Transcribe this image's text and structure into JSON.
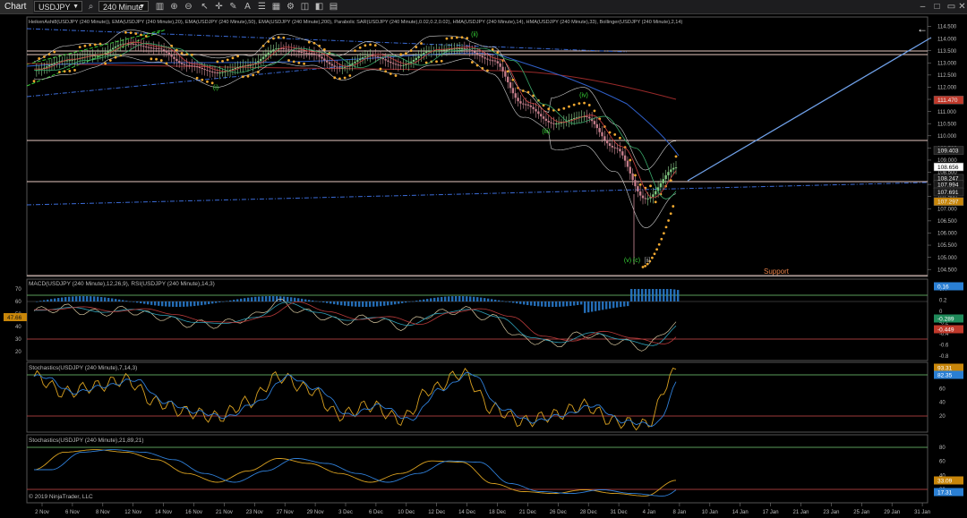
{
  "toolbar": {
    "title": "Chart",
    "instrument": "USDJPY",
    "interval": "240 Minute",
    "icons": [
      "search-icon",
      "zoom-in-icon",
      "zoom-out-icon",
      "crosshair-icon",
      "pointer-icon",
      "draw-icon",
      "text-icon",
      "properties-icon",
      "layout-icon",
      "settings-icon",
      "lock-icon",
      "hide-icon",
      "tile-icon"
    ],
    "window_controls": [
      "minimize-icon",
      "maximize-icon",
      "close-icon"
    ]
  },
  "price_panel": {
    "indicator_label": "HeikenAshi8(USDJPY (240 Minute)), EMA(USDJPY (240 Minute),20), EMA(USDJPY (240 Minute),50), EMA(USDJPY (240 Minute),200), Parabolic SAR(USDJPY (240 Minute),0.02,0.2,0.02), HMA(USDJPY (240 Minute),14), HMA(USDJPY (240 Minute),33), Bollinger(USDJPY (240 Minute),2,14)",
    "y_ticks": [
      "114.500",
      "114.000",
      "113.500",
      "113.000",
      "112.500",
      "112.000",
      "111.500",
      "111.000",
      "110.500",
      "110.000",
      "109.500",
      "109.000",
      "108.500",
      "108.000",
      "107.500",
      "107.000",
      "106.500",
      "106.000",
      "105.500",
      "105.000",
      "104.500"
    ],
    "tick_values": [
      114.5,
      114.0,
      113.5,
      113.0,
      112.5,
      112.0,
      111.5,
      111.0,
      110.5,
      110.0,
      109.5,
      109.0,
      108.5,
      108.0,
      107.5,
      107.0,
      106.5,
      106.0,
      105.5,
      105.0,
      104.5
    ],
    "badges": [
      {
        "text": "111.470",
        "value": 111.47,
        "color": "#c0392b"
      },
      {
        "text": "109.403",
        "value": 109.4,
        "color": "#222222"
      },
      {
        "text": "108.656",
        "value": 108.72,
        "color": "#ffffff"
      },
      {
        "text": "108.247",
        "value": 108.247,
        "color": "#1a1a1a"
      },
      {
        "text": "107.994",
        "value": 107.994,
        "color": "#1a1a1a"
      },
      {
        "text": "107.691",
        "value": 107.691,
        "color": "#1a1a1a"
      },
      {
        "text": "107.297",
        "value": 107.297,
        "color": "#c8860a"
      }
    ],
    "wave_labels": [
      {
        "text": "(i)",
        "x": 241,
        "value": 111.9
      },
      {
        "text": "(ii)",
        "x": 530,
        "value": 114.1
      },
      {
        "text": "(iii)",
        "x": 610,
        "value": 110.1
      },
      {
        "text": "(iv)",
        "x": 652,
        "value": 111.6
      },
      {
        "text": "(v)",
        "x": 701,
        "value": 104.8
      },
      {
        "text": "(c)",
        "x": 711,
        "value": 104.8
      },
      {
        "text": "[ii]",
        "x": 723,
        "value": 104.8
      }
    ],
    "support_label": "Support"
  },
  "macd_panel": {
    "label": "MACD(USDJPY (240 Minute),12,26,9), RSI(USDJPY (240 Minute),14,3)",
    "left_ticks": [
      "70",
      "60",
      "50",
      "40",
      "30",
      "20"
    ],
    "left_badge": "47.66",
    "right_ticks": [
      "0.4",
      "0.2",
      "0",
      "-0.2",
      "-0.4",
      "-0.6",
      "-0.8"
    ],
    "right_badges": [
      {
        "text": "0.16",
        "color": "#2a7fd4"
      },
      {
        "text": "-0.289",
        "color": "#1f8a5a"
      },
      {
        "text": "-0.449",
        "color": "#c0392b"
      }
    ]
  },
  "stoch1_panel": {
    "label": "Stochastics(USDJPY (240 Minute),7,14,3)",
    "right_ticks": [
      "80",
      "60",
      "40",
      "20"
    ],
    "right_badges": [
      {
        "text": "93.31",
        "color": "#c8860a"
      },
      {
        "text": "82.35",
        "color": "#2a7fd4"
      }
    ]
  },
  "stoch2_panel": {
    "label": "Stochastics(USDJPY (240 Minute),21,89,21)",
    "right_ticks": [
      "80",
      "60",
      "40",
      "20"
    ],
    "right_badges": [
      {
        "text": "33.09",
        "color": "#c8860a"
      },
      {
        "text": "17.31",
        "color": "#2a7fd4"
      }
    ],
    "copyright": "© 2019 NinjaTrader, LLC"
  },
  "chart_data": {
    "type": "line",
    "x_dates": [
      "2 Nov",
      "6 Nov",
      "8 Nov",
      "12 Nov",
      "14 Nov",
      "16 Nov",
      "21 Nov",
      "23 Nov",
      "27 Nov",
      "29 Nov",
      "3 Dec",
      "6 Dec",
      "10 Dec",
      "12 Dec",
      "14 Dec",
      "18 Dec",
      "21 Dec",
      "26 Dec",
      "28 Dec",
      "31 Dec",
      "4 Jan",
      "8 Jan",
      "10 Jan",
      "14 Jan",
      "17 Jan",
      "21 Jan",
      "23 Jan",
      "25 Jan",
      "29 Jan",
      "31 Jan"
    ],
    "price": [
      112.7,
      113.1,
      113.3,
      113.8,
      113.6,
      112.9,
      112.6,
      112.9,
      113.6,
      113.4,
      112.8,
      113.3,
      112.9,
      113.5,
      113.6,
      113.1,
      111.3,
      110.5,
      110.8,
      109.5,
      107.4,
      108.7
    ],
    "rsi": [
      57,
      60,
      55,
      58,
      52,
      45,
      44,
      50,
      65,
      55,
      47,
      50,
      42,
      54,
      58,
      50,
      30,
      25,
      35,
      28,
      22,
      45
    ],
    "stoch_fast_k": [
      85,
      60,
      70,
      80,
      45,
      30,
      22,
      45,
      85,
      65,
      25,
      40,
      18,
      65,
      90,
      35,
      15,
      25,
      40,
      15,
      10,
      93
    ],
    "stoch_slow_k": [
      50,
      78,
      82,
      78,
      66,
      44,
      30,
      48,
      68,
      60,
      44,
      30,
      44,
      64,
      62,
      28,
      15,
      12,
      18,
      12,
      8,
      33
    ],
    "ylim": [
      104.25,
      114.85
    ],
    "grid": false
  }
}
